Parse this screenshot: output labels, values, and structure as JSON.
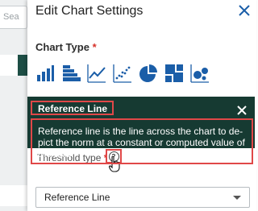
{
  "background": {
    "search_placeholder": "Sea",
    "colors": {
      "backdrop": "#eef0f1",
      "accent": "#1d4e45"
    }
  },
  "panel": {
    "title": "Edit Chart Settings",
    "close_icon": "close-icon"
  },
  "chart_type": {
    "label": "Chart Type",
    "required_mark": "*",
    "icons": [
      {
        "name": "vertical-bar-chart-icon",
        "selected": false
      },
      {
        "name": "horizontal-bar-chart-icon",
        "selected": false
      },
      {
        "name": "line-chart-icon",
        "selected": false
      },
      {
        "name": "scatter-chart-icon",
        "selected": false
      },
      {
        "name": "pie-chart-icon",
        "selected": false
      },
      {
        "name": "treemap-chart-icon",
        "selected": false
      },
      {
        "name": "bubble-chart-icon",
        "selected": false
      }
    ],
    "icon_color": "#1b5ea8"
  },
  "tooltip": {
    "title": "Reference Line",
    "body": "Reference line is the line across the chart to de-pict the norm at a constant or computed value of the axis.",
    "close_icon": "close-icon",
    "colors": {
      "bg": "#163a32",
      "highlight": "#e04848"
    }
  },
  "threshold": {
    "label": "Threshold type",
    "required_mark": "*",
    "help_icon": "help-icon",
    "select_value": "Reference Line"
  }
}
